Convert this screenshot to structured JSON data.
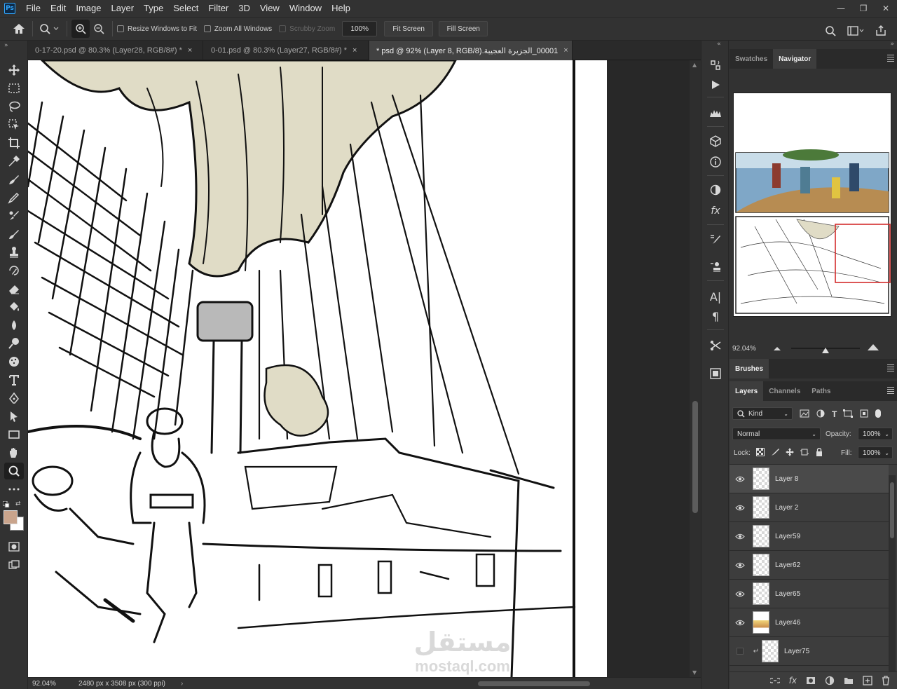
{
  "app": {
    "logo_text": "Ps"
  },
  "menu": [
    "File",
    "Edit",
    "Image",
    "Layer",
    "Type",
    "Select",
    "Filter",
    "3D",
    "View",
    "Window",
    "Help"
  ],
  "window_controls": {
    "minimize": "—",
    "restore": "❐",
    "close": "✕"
  },
  "options_bar": {
    "resize_windows": "Resize Windows to Fit",
    "zoom_all": "Zoom All Windows",
    "scrubby_zoom": "Scrubby Zoom",
    "zoom_value": "100%",
    "fit_screen": "Fit Screen",
    "fill_screen": "Fill Screen"
  },
  "tabs": [
    {
      "label": "0-17-20.psd @ 80.3% (Layer28, RGB/8#) *",
      "active": false
    },
    {
      "label": "0-01.psd @ 80.3% (Layer27, RGB/8#) *",
      "active": false
    },
    {
      "label": "00001_الجزيرة العجيبة.psd @ 92% (Layer 8, RGB/8) *",
      "active": true
    }
  ],
  "tab_close_glyph": "×",
  "status": {
    "zoom": "92.04%",
    "doc_info": "2480 px x 3508 px (300 ppi)",
    "arrow": "›"
  },
  "watermark": {
    "arabic": "مستقل",
    "latin": "mostaql.com"
  },
  "navigator": {
    "tabs": [
      "Swatches",
      "Navigator"
    ],
    "active_tab": "Navigator",
    "zoom": "92.04%"
  },
  "brushes_panel": {
    "title": "Brushes"
  },
  "layers_panel": {
    "tabs": [
      "Layers",
      "Channels",
      "Paths"
    ],
    "active_tab": "Layers",
    "filter_kind": "Kind",
    "blend_mode": "Normal",
    "opacity_label": "Opacity:",
    "opacity": "100%",
    "lock_label": "Lock:",
    "fill_label": "Fill:",
    "fill": "100%",
    "layers": [
      {
        "name": "Layer 8",
        "visible": true,
        "selected": true
      },
      {
        "name": "Layer 2",
        "visible": true,
        "selected": false
      },
      {
        "name": "Layer59",
        "visible": true,
        "selected": false
      },
      {
        "name": "Layer62",
        "visible": true,
        "selected": false
      },
      {
        "name": "Layer65",
        "visible": true,
        "selected": false
      },
      {
        "name": "Layer46",
        "visible": true,
        "selected": false
      },
      {
        "name": "Layer75",
        "visible": false,
        "selected": false,
        "clipped": true
      }
    ]
  },
  "colors": {
    "foreground": "#c9a48c",
    "background": "#ffffff",
    "accent": "#31a8ff",
    "sail": "#e0dcc6"
  }
}
